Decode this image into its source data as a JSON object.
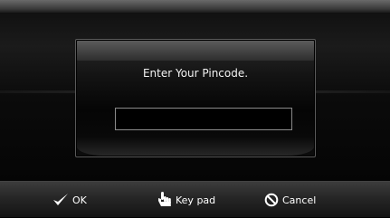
{
  "dialog": {
    "prompt": "Enter Your Pincode.",
    "pin_value": ""
  },
  "toolbar": {
    "ok_label": "OK",
    "keypad_label": "Key pad",
    "cancel_label": "Cancel"
  },
  "icons": {
    "ok": "checkmark-icon",
    "keypad": "pointing-hand-icon",
    "cancel": "prohibited-circle-icon"
  },
  "colors": {
    "background": "#000000",
    "text": "#ffffff",
    "input_border": "#8a8a8a"
  }
}
